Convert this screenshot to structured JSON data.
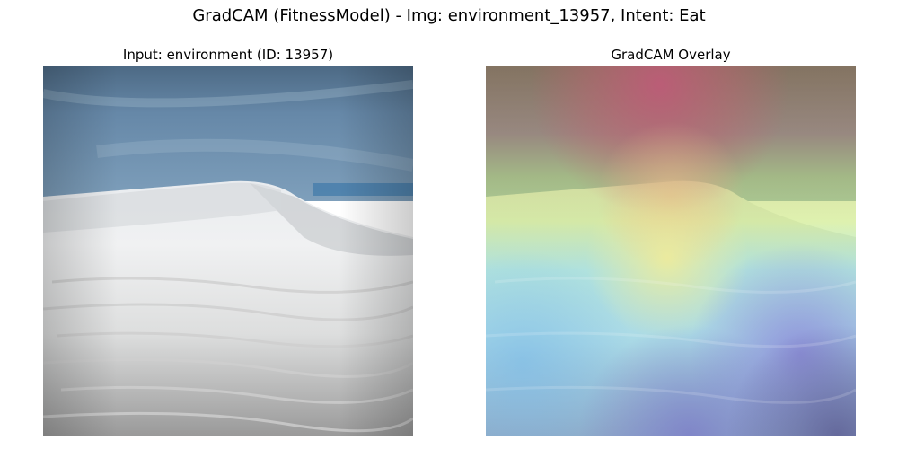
{
  "figure": {
    "title": "GradCAM (FitnessModel) - Img: environment_13957, Intent: Eat"
  },
  "panels": [
    {
      "title": "Input: environment (ID: 13957)",
      "content": "sand dune landscape photograph under blue sky"
    },
    {
      "title": "GradCAM Overlay",
      "content": "same photograph overlaid with jet-colormap heatmap"
    }
  ]
}
